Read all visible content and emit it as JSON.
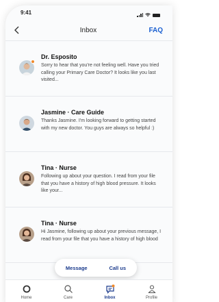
{
  "status_bar": {
    "time": "9:41"
  },
  "header": {
    "back_icon": "chevron-left-icon",
    "title": "Inbox",
    "faq_label": "FAQ"
  },
  "messages": [
    {
      "name": "Dr. Esposito",
      "preview": "Sorry to hear that you're not feeling well. Have you tried calling your Primary Care Doctor? It looks like you last visited...",
      "unread": true
    },
    {
      "name": "Jasmine · Care Guide",
      "preview": "Thanks Jasmine. I'm looking forward to getting started with my new doctor. You guys are always so helpful :)",
      "unread": false
    },
    {
      "name": "Tina · Nurse",
      "preview": "Following up about your question. I read from your file that you have a history of high blood pressure. It looks like your...",
      "unread": false
    },
    {
      "name": "Tina · Nurse",
      "preview": "Hi Jasmine, following up about your previous message, I read from your file that you have a history of high blood",
      "unread": false
    }
  ],
  "floating_actions": {
    "message_label": "Message",
    "call_label": "Call us"
  },
  "tabs": [
    {
      "label": "Home",
      "icon": "home-icon",
      "active": false
    },
    {
      "label": "Care",
      "icon": "search-icon",
      "active": false
    },
    {
      "label": "Inbox",
      "icon": "chat-icon",
      "active": true
    },
    {
      "label": "Profile",
      "icon": "profile-icon",
      "active": false
    }
  ],
  "colors": {
    "accent": "#1a3a8c",
    "link": "#1a5fd0",
    "unread": "#f08a2b"
  }
}
